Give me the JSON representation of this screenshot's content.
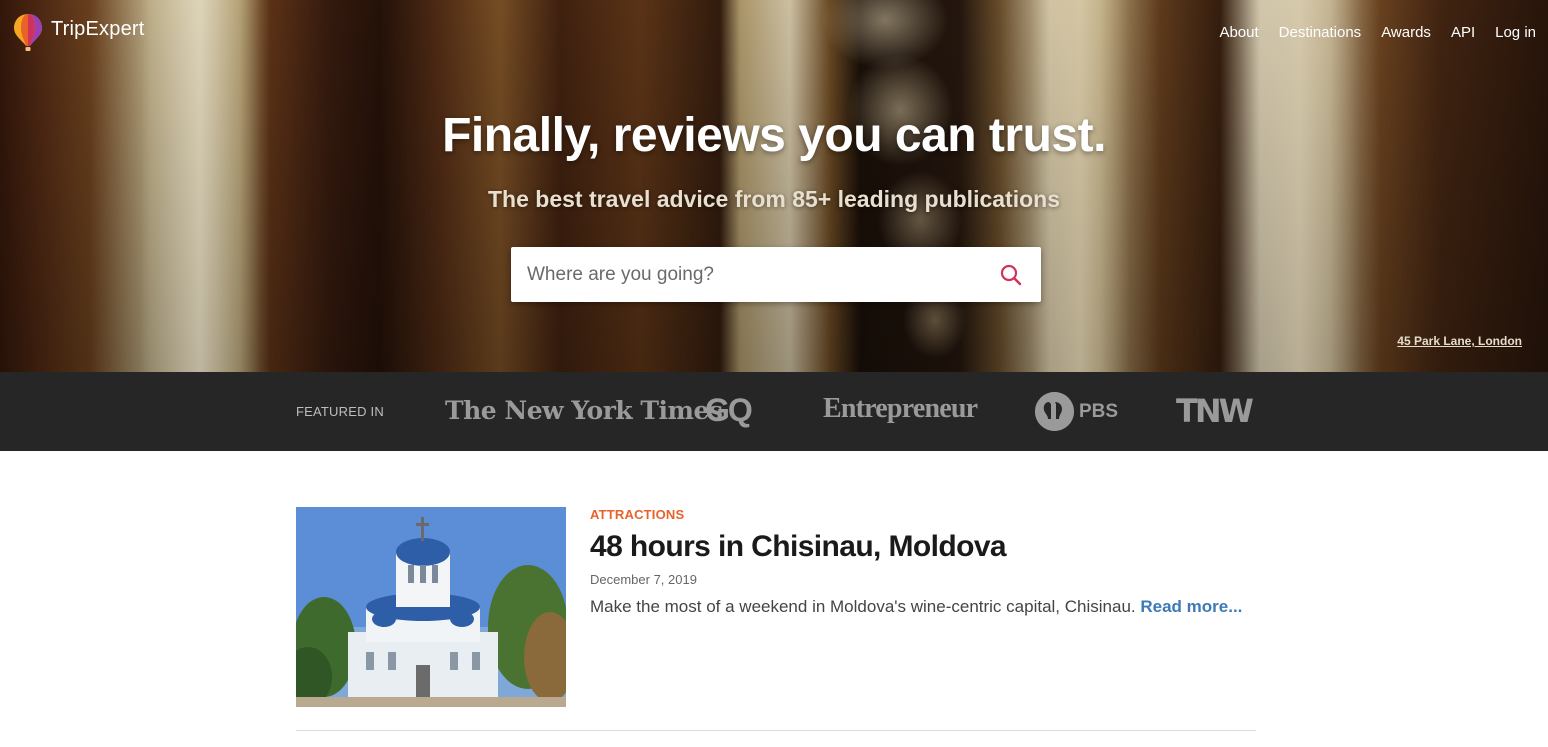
{
  "brand": {
    "name": "TripExpert"
  },
  "nav": {
    "items": [
      "About",
      "Destinations",
      "Awards",
      "API",
      "Log in"
    ]
  },
  "hero": {
    "title": "Finally, reviews you can trust.",
    "subtitle": "The best travel advice from 85+ leading publications",
    "search_placeholder": "Where are you going?",
    "photo_credit": "45 Park Lane, London"
  },
  "featured": {
    "label": "FEATURED IN",
    "publications": [
      "The New York Times",
      "GQ",
      "Entrepreneur",
      "PBS",
      "TNW"
    ]
  },
  "article": {
    "category": "ATTRACTIONS",
    "title": "48 hours in Chisinau, Moldova",
    "date": "December 7, 2019",
    "description": "Make the most of a weekend in Moldova's wine-centric capital, Chisinau.",
    "read_more": "Read more..."
  },
  "colors": {
    "accent": "#e8622a",
    "link": "#3d7ab6",
    "featured_bg": "#262626",
    "search_icon": "#d0325a"
  }
}
